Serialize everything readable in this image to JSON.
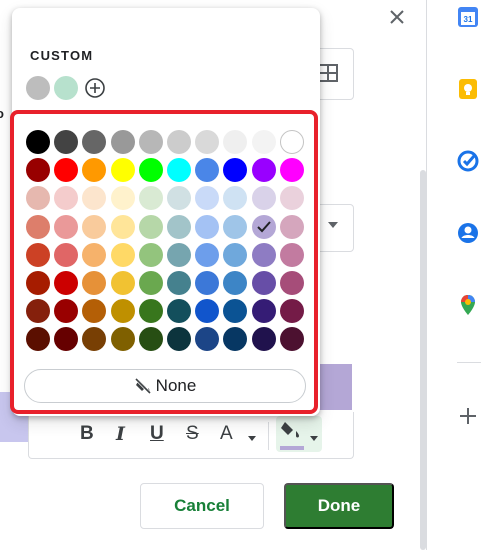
{
  "picker": {
    "custom_label": "CUSTOM",
    "custom_colors": [
      "#bdbdbd",
      "#b7e1cd"
    ],
    "none_label": "None",
    "selected_color": "#b4a7d6",
    "grid": [
      [
        "#000000",
        "#434343",
        "#666666",
        "#999999",
        "#b7b7b7",
        "#cccccc",
        "#d9d9d9",
        "#efefef",
        "#f3f3f3",
        "#ffffff"
      ],
      [
        "#980000",
        "#ff0000",
        "#ff9900",
        "#ffff00",
        "#00ff00",
        "#00ffff",
        "#4a86e8",
        "#0000ff",
        "#9900ff",
        "#ff00ff"
      ],
      [
        "#e6b8af",
        "#f4cccc",
        "#fce5cd",
        "#fff2cc",
        "#d9ead3",
        "#d0e0e3",
        "#c9daf8",
        "#cfe2f3",
        "#d9d2e9",
        "#ead1dc"
      ],
      [
        "#dd7e6b",
        "#ea9999",
        "#f9cb9c",
        "#ffe599",
        "#b6d7a8",
        "#a2c4c9",
        "#a4c2f4",
        "#9fc5e8",
        "#b4a7d6",
        "#d5a6bd"
      ],
      [
        "#cc4125",
        "#e06666",
        "#f6b26b",
        "#ffd966",
        "#93c47d",
        "#76a5af",
        "#6d9eeb",
        "#6fa8dc",
        "#8e7cc3",
        "#c27ba0"
      ],
      [
        "#a61c00",
        "#cc0000",
        "#e69138",
        "#f1c232",
        "#6aa84f",
        "#45818e",
        "#3c78d8",
        "#3d85c6",
        "#674ea7",
        "#a64d79"
      ],
      [
        "#85200c",
        "#990000",
        "#b45f06",
        "#bf9000",
        "#38761d",
        "#134f5c",
        "#1155cc",
        "#0b5394",
        "#351c75",
        "#741b47"
      ],
      [
        "#5b0f00",
        "#660000",
        "#783f04",
        "#7f6000",
        "#274e13",
        "#0c343d",
        "#1c4587",
        "#073763",
        "#20124d",
        "#4c1130"
      ]
    ]
  },
  "toolbar": {
    "bold": "B",
    "italic": "I",
    "underline": "U",
    "strikethrough": "S",
    "text_color": "A",
    "fill_color": "#b4a7d6"
  },
  "buttons": {
    "cancel": "Cancel",
    "done": "Done"
  },
  "sidebar_apps": [
    "calendar-icon",
    "keep-icon",
    "tasks-icon",
    "contacts-icon",
    "maps-icon"
  ],
  "calendar_day": "31",
  "highlight_color": "#e8212b"
}
